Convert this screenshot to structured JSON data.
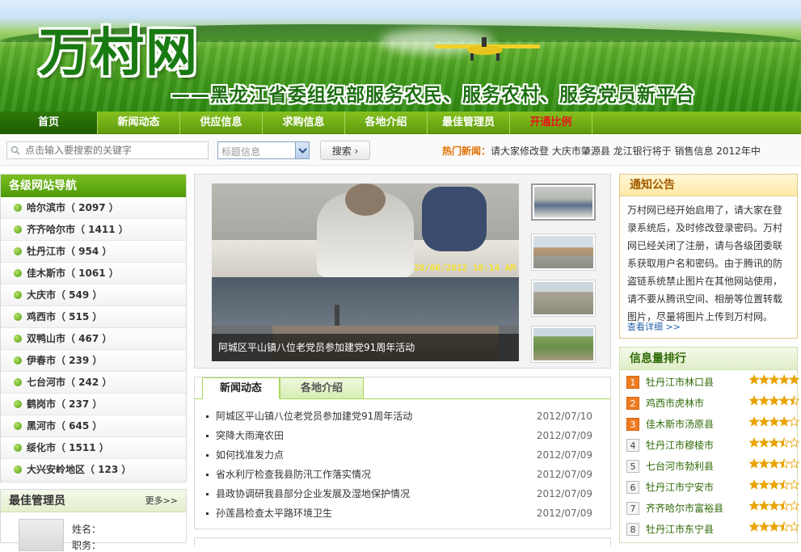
{
  "header": {
    "logo": "万村网",
    "slogan": "——黑龙江省委组织部服务农民、服务农村、服务党员新平台"
  },
  "nav": [
    {
      "label": "首页",
      "active": true
    },
    {
      "label": "新闻动态"
    },
    {
      "label": "供应信息"
    },
    {
      "label": "求购信息"
    },
    {
      "label": "各地介绍"
    },
    {
      "label": "最佳管理员"
    },
    {
      "label": "开通比例",
      "highlight": "#e8141a"
    }
  ],
  "search": {
    "placeholder": "点击输入要搜索的关键字",
    "select_value": "标题信息",
    "button": "搜索 ›"
  },
  "hot_news": {
    "label": "热门新闻：",
    "text": "请大家修改登  大庆市肇源县  龙江银行将于  销售信息  2012年中"
  },
  "region_nav": {
    "title": "各级网站导航",
    "items": [
      "哈尔滨市（ 2097 ）",
      "齐齐哈尔市（ 1411 ）",
      "牡丹江市（ 954 ）",
      "佳木斯市（ 1061 ）",
      "大庆市（ 549 ）",
      "鸡西市（ 515 ）",
      "双鸭山市（ 467 ）",
      "伊春市（ 239 ）",
      "七台河市（ 242 ）",
      "鹤岗市（ 237 ）",
      "黑河市（ 645 ）",
      "绥化市（ 1511 ）",
      "大兴安岭地区（ 123 ）"
    ]
  },
  "managers": {
    "title": "最佳管理员",
    "more": "更多>>",
    "name_label": "姓名：",
    "role_label": "职务："
  },
  "slider": {
    "caption": "阿城区平山镇八位老党员参加建党91周年活动",
    "timestamp": "28/06/2012 10:14 AM"
  },
  "news_tabs": {
    "tabs": [
      "新闻动态",
      "各地介绍"
    ],
    "items": [
      {
        "title": "阿城区平山镇八位老党员参加建党91周年活动",
        "date": "2012/07/10"
      },
      {
        "title": "突降大雨淹农田",
        "date": "2012/07/09"
      },
      {
        "title": "如何找准发力点",
        "date": "2012/07/09"
      },
      {
        "title": "省水利厅检查我县防汛工作落实情况",
        "date": "2012/07/09"
      },
      {
        "title": "县政协调研我县部分企业发展及湿地保护情况",
        "date": "2012/07/09"
      },
      {
        "title": "孙莲昌检查太平路环境卫生",
        "date": "2012/07/09"
      }
    ]
  },
  "notice": {
    "title": "通知公告",
    "body": "万村网已经开始启用了，请大家在登录系统后，及时修改登录密码。万村网已经关闭了注册，请与各级团委联系获取用户名和密码。由于腾讯的防盗链系统禁止图片在其他网站使用，请不要从腾讯空间、相册等位置转载图片，尽量将图片上传到万村网。",
    "more": "查看详细 >>"
  },
  "ranking": {
    "title": "信息量排行",
    "star_color": "#e9a300",
    "items": [
      {
        "rank": "1",
        "name": "牡丹江市林口县",
        "stars": 5
      },
      {
        "rank": "2",
        "name": "鸡西市虎林市",
        "stars": 4.5
      },
      {
        "rank": "3",
        "name": "佳木斯市汤原县",
        "stars": 4
      },
      {
        "rank": "4",
        "name": "牡丹江市穆棱市",
        "stars": 3.5
      },
      {
        "rank": "5",
        "name": "七台河市勃利县",
        "stars": 3.5
      },
      {
        "rank": "6",
        "name": "牡丹江市宁安市",
        "stars": 3.5
      },
      {
        "rank": "7",
        "name": "齐齐哈尔市富裕县",
        "stars": 3.5
      },
      {
        "rank": "8",
        "name": "牡丹江市东宁县",
        "stars": 3.5
      }
    ]
  }
}
